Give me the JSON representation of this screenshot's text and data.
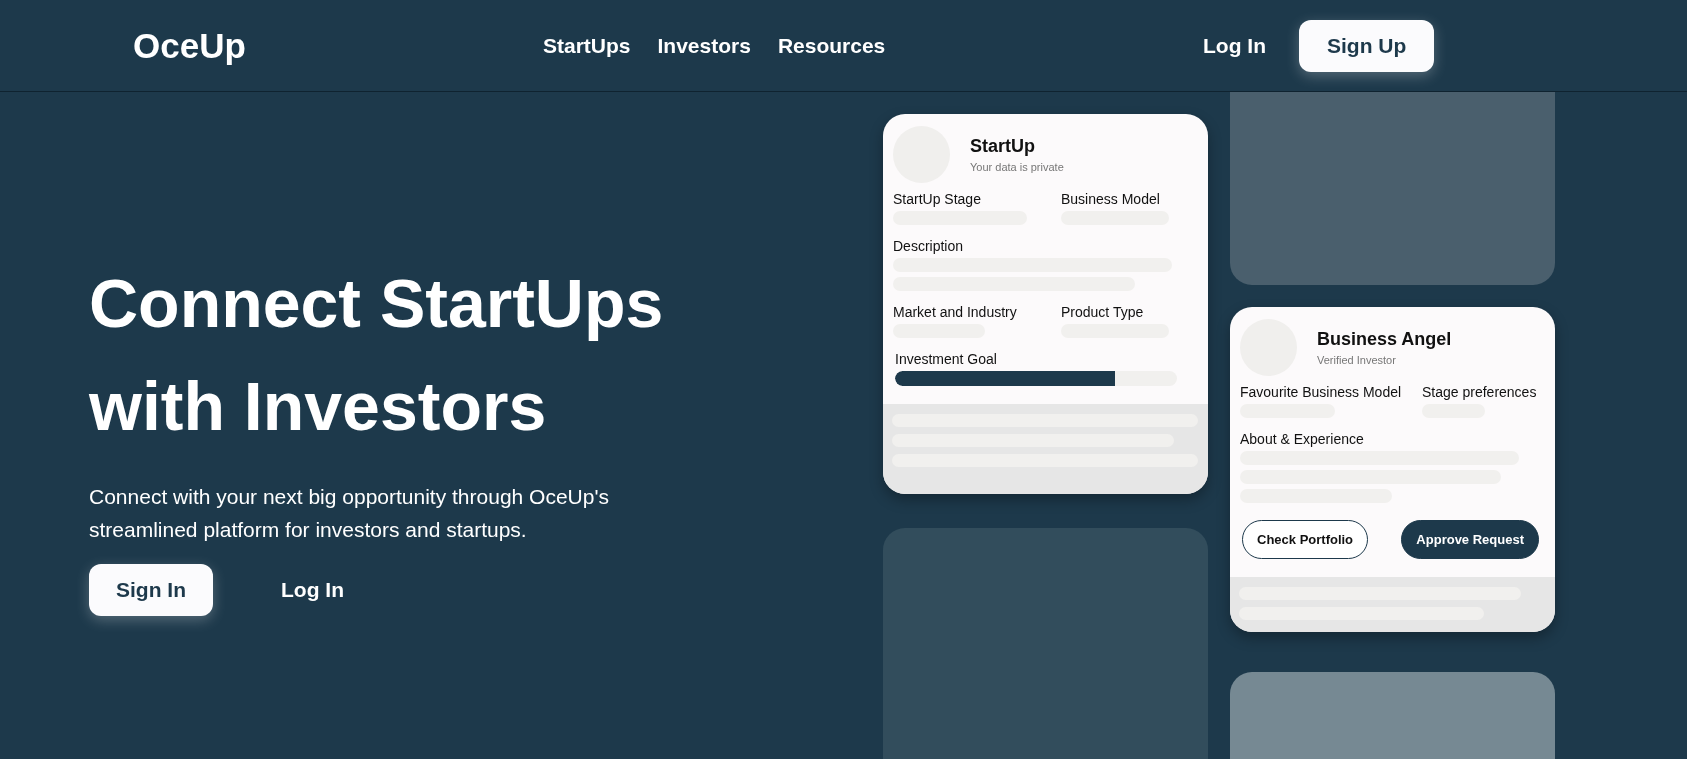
{
  "header": {
    "logo": "OceUp",
    "nav": [
      "StartUps",
      "Investors",
      "Resources"
    ],
    "login": "Log In",
    "signup": "Sign Up"
  },
  "hero": {
    "title_lines": [
      "Connect StartUps",
      "with Investors"
    ],
    "subtitle": "Connect with your next big opportunity through OceUp's streamlined platform for investors and startups.",
    "primary_button": "Sign In",
    "secondary_button": "Log In"
  },
  "startup_card": {
    "title": "StartUp",
    "subtitle": "Your data is private",
    "fields": [
      {
        "label": "StartUp Stage"
      },
      {
        "label": "Business Model"
      },
      {
        "label": "Description"
      },
      {
        "label": "Market and Industry"
      },
      {
        "label": "Product Type"
      }
    ],
    "goal": {
      "label": "Investment Goal",
      "level": 0.78
    }
  },
  "investor_card": {
    "title": "Business Angel",
    "subtitle": "Verified Investor",
    "fields": [
      {
        "label": "Favourite Business Model"
      },
      {
        "label": "Stage preferences"
      },
      {
        "label": "About & Experience"
      }
    ],
    "buttons": [
      {
        "label": "Check Portfolio",
        "kind": "outline"
      },
      {
        "label": "Approve Request",
        "kind": "filled"
      }
    ]
  }
}
